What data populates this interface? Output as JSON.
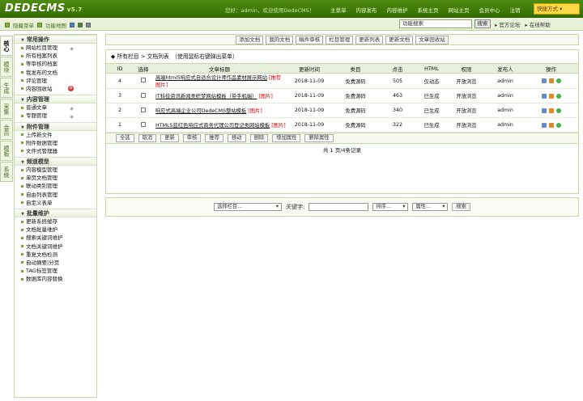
{
  "header": {
    "logo": "DEDECMS",
    "version": "v5.7",
    "welcome": "您好：admin，欢迎使用DedeCMS！",
    "nav": [
      "主菜单",
      "内容发布",
      "内容维护",
      "系统主页",
      "网站主页",
      "会员中心",
      "注销"
    ],
    "quick_label": "快捷方式 ▾"
  },
  "subbar": {
    "hide_menu": "隐藏菜单",
    "func_map": "功能地图",
    "search_value": "功能搜索",
    "search_button": "搜索",
    "official_forum": "官方论坛",
    "online_help": "在线帮助"
  },
  "tabs": [
    "核心",
    "模块",
    "生成",
    "采集",
    "会员",
    "模板",
    "系统"
  ],
  "sidebar": {
    "sections": [
      {
        "title": "常用操作",
        "items": [
          "网站栏目管理",
          "所有档案列表",
          "等审核的档案",
          "我发布的文档",
          "评论管理",
          "内容回收站"
        ]
      },
      {
        "title": "内容管理",
        "items": [
          "普通文章",
          "专题管理"
        ]
      },
      {
        "title": "附件管理",
        "items": [
          "上传新文件",
          "附件数据管理",
          "文件式管理器"
        ]
      },
      {
        "title": "频道模型",
        "items": [
          "内容模型管理",
          "单页文档管理",
          "联动类别管理",
          "自由列表管理",
          "自定义表单"
        ]
      },
      {
        "title": "批量维护",
        "items": [
          "更新系统缓存",
          "文档批量维护",
          "搜索关键词维护",
          "文档关键词维护",
          "重复文档检测",
          "自动摘要|分页",
          "TAG标签管理",
          "数据库内容替换"
        ]
      }
    ]
  },
  "toolbar": [
    "添加文档",
    "我的文档",
    "稿件审核",
    "栏目管理",
    "更新列表",
    "更新文档",
    "文章回收站"
  ],
  "list": {
    "heading": "◆ 所有栏目 > 文档列表　（使用鼠标右键弹出菜单）",
    "columns": [
      "ID",
      "选择",
      "文章标题",
      "更新时间",
      "类目",
      "点击",
      "HTML",
      "权限",
      "发布人",
      "操作"
    ],
    "rows": [
      {
        "id": "4",
        "title": "高端html5响应式自适合设计师作品素材展示网站",
        "tags": "[推荐 图片]",
        "time": "2018-11-09",
        "cat": "免费源码",
        "clicks": "505",
        "html": "仅动态",
        "perm": "开放浏览",
        "user": "admin"
      },
      {
        "id": "3",
        "title": "IT科技资讯新闻类织梦网站模板（带手机端）",
        "tags": "[图片]",
        "time": "2018-11-09",
        "cat": "免费源码",
        "clicks": "463",
        "html": "已生成",
        "perm": "开放浏览",
        "user": "admin"
      },
      {
        "id": "2",
        "title": "响应式高端企业公司DedeCMS整站模板",
        "tags": "[图片]",
        "time": "2018-11-09",
        "cat": "免费源码",
        "clicks": "340",
        "html": "已生成",
        "perm": "开放浏览",
        "user": "admin"
      },
      {
        "id": "1",
        "title": "HTML5蓝红色响应式商务代理公司登记类网站模板",
        "tags": "[图片]",
        "time": "2018-11-09",
        "cat": "免费源码",
        "clicks": "322",
        "html": "已生成",
        "perm": "开放浏览",
        "user": "admin"
      }
    ],
    "batch": [
      "全选",
      "取消",
      "更新",
      "审核",
      "推荐",
      "移动",
      "删除",
      "增加属性",
      "删除属性"
    ],
    "pager": "共 1 页/4条记录"
  },
  "search": {
    "column_select": "选择栏目...",
    "keyword_label": "关键字:",
    "sort_select": "排序...",
    "attr_select": "属性...",
    "button": "搜索"
  }
}
